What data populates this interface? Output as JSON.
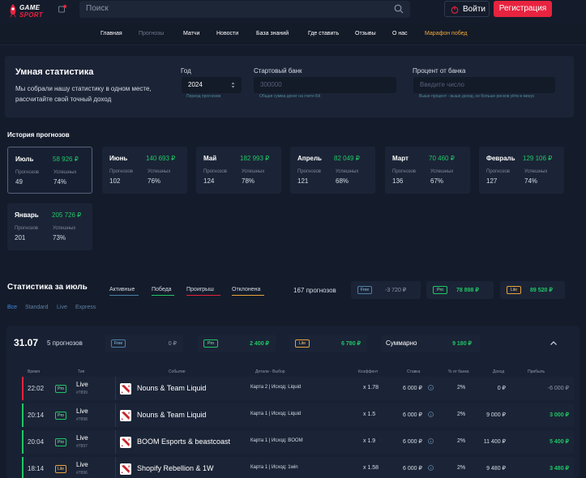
{
  "header": {
    "logo_top": "GAME",
    "logo_bottom": "SPORT",
    "search_placeholder": "Поиск",
    "login": "Войти",
    "register": "Регистрация"
  },
  "nav": [
    "Главная",
    "Прогнозы",
    "Матчи",
    "Новости",
    "База знаний",
    "Где ставить",
    "Отзывы",
    "О нас",
    "Марафон побед"
  ],
  "smart": {
    "title": "Умная статистика",
    "desc": "Мы собрали нашу статистику в одном месте, рассчитайте свой точный доход",
    "year_label": "Год",
    "year_value": "2024",
    "year_hint": "Период прогнозов",
    "bank_label": "Стартовый банк",
    "bank_value": "300000",
    "bank_hint": "Общая сумма денег на счете БК",
    "pct_label": "Процент от банка",
    "pct_placeholder": "Введите число",
    "pct_hint": "Выше процент - выше доход, но больше рисков уйти в минус"
  },
  "history": {
    "title": "История прогнозов",
    "lbl_count": "Прогнозов",
    "lbl_success": "Успешных",
    "months": [
      {
        "name": "Июль",
        "profit": "58 926 ₽",
        "count": "49",
        "success": "74%"
      },
      {
        "name": "Июнь",
        "profit": "140 693 ₽",
        "count": "102",
        "success": "76%"
      },
      {
        "name": "Май",
        "profit": "182 993 ₽",
        "count": "124",
        "success": "78%"
      },
      {
        "name": "Апрель",
        "profit": "82 049 ₽",
        "count": "121",
        "success": "68%"
      },
      {
        "name": "Март",
        "profit": "70 460 ₽",
        "count": "136",
        "success": "67%"
      },
      {
        "name": "Февраль",
        "profit": "129 106 ₽",
        "count": "127",
        "success": "74%"
      },
      {
        "name": "Январь",
        "profit": "205 726 ₽",
        "count": "201",
        "success": "73%"
      }
    ]
  },
  "stats": {
    "title": "Статистика за июль",
    "legend": [
      "Активные",
      "Победа",
      "Проигрыш",
      "Отклонена"
    ],
    "total": "167 прогнозов",
    "free_tag": "Free",
    "free_val": "-3 720 ₽",
    "pro_tag": "Pro",
    "pro_val": "78 898 ₽",
    "lite_tag": "Lite",
    "lite_val": "89 520 ₽",
    "filters": [
      "Все",
      "Standard",
      "Live",
      "Express"
    ]
  },
  "day": {
    "date": "31.07",
    "count": "5 прогнозов",
    "free_val": "0 ₽",
    "pro_val": "2 400 ₽",
    "lite_val": "6 780 ₽",
    "sum_label": "Суммарно",
    "sum_val": "9 180 ₽"
  },
  "table": {
    "headers": [
      "Время",
      "Тип",
      "Событие",
      "Детали - Выбор",
      "Коэффент",
      "Ставка",
      "% от банка",
      "Доход",
      "Прибыль"
    ],
    "rows": [
      {
        "time": "22:02",
        "tag": "Pro",
        "kind": "Live",
        "id": "#7899",
        "event": "Nouns & Team Liquid",
        "details": "Карта 2 | Исход: Liquid",
        "coef": "x 1.78",
        "stake": "6 000 ₽",
        "pct": "2%",
        "income": "0 ₽",
        "profit": "-6 000 ₽",
        "status": "loss"
      },
      {
        "time": "20:14",
        "tag": "Pro",
        "kind": "Live",
        "id": "#7898",
        "event": "Nouns & Team Liquid",
        "details": "Карта 1 | Исход: Liquid",
        "coef": "x 1.5",
        "stake": "6 000 ₽",
        "pct": "2%",
        "income": "9 000 ₽",
        "profit": "3 000 ₽",
        "status": "win"
      },
      {
        "time": "20:04",
        "tag": "Pro",
        "kind": "Live",
        "id": "#7897",
        "event": "BOOM Esports & beastcoast",
        "details": "Карта 1 | Исход: BOOM",
        "coef": "x 1.9",
        "stake": "6 000 ₽",
        "pct": "2%",
        "income": "11 400 ₽",
        "profit": "5 400 ₽",
        "status": "win"
      },
      {
        "time": "18:14",
        "tag": "Lite",
        "kind": "Live",
        "id": "#7896",
        "event": "Shopify Rebellion & 1W",
        "details": "Карта 1 | Исход: 1win",
        "coef": "x 1.58",
        "stake": "6 000 ₽",
        "pct": "2%",
        "income": "9 480 ₽",
        "profit": "3 480 ₽",
        "status": "win"
      }
    ]
  },
  "colors": {
    "accent": "#e8233f",
    "win": "#1fc766",
    "loss": "#e8233f",
    "pro": "#1fc766",
    "lite": "#e9a23b",
    "free": "#4a7fa8"
  }
}
